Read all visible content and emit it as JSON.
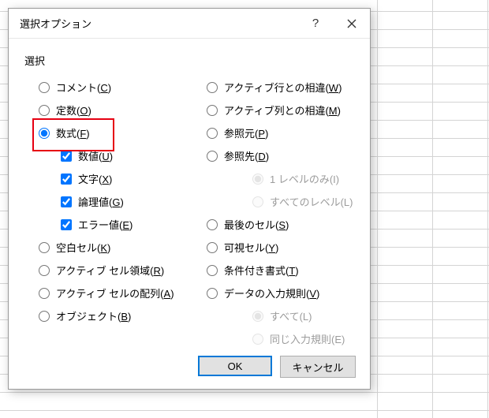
{
  "dialog": {
    "title": "選択オプション",
    "section_label": "選択",
    "left": {
      "comment": {
        "label": "コメント(",
        "accel": "C",
        "suffix": ")"
      },
      "constants": {
        "label": "定数(",
        "accel": "O",
        "suffix": ")"
      },
      "formulas": {
        "label": "数式(",
        "accel": "F",
        "suffix": ")"
      },
      "sub_number": {
        "label": "数値(",
        "accel": "U",
        "suffix": ")"
      },
      "sub_text": {
        "label": "文字(",
        "accel": "X",
        "suffix": ")"
      },
      "sub_logical": {
        "label": "論理値(",
        "accel": "G",
        "suffix": ")"
      },
      "sub_error": {
        "label": "エラー値(",
        "accel": "E",
        "suffix": ")"
      },
      "blanks": {
        "label": "空白セル(",
        "accel": "K",
        "suffix": ")"
      },
      "current_region": {
        "label": "アクティブ セル領域(",
        "accel": "R",
        "suffix": ")"
      },
      "current_array": {
        "label": "アクティブ セルの配列(",
        "accel": "A",
        "suffix": ")"
      },
      "objects": {
        "label": "オブジェクト(",
        "accel": "B",
        "suffix": ")"
      }
    },
    "right": {
      "row_diff": {
        "label": "アクティブ行との相違(",
        "accel": "W",
        "suffix": ")"
      },
      "col_diff": {
        "label": "アクティブ列との相違(",
        "accel": "M",
        "suffix": ")"
      },
      "precedents": {
        "label": "参照元(",
        "accel": "P",
        "suffix": ")"
      },
      "dependents": {
        "label": "参照先(",
        "accel": "D",
        "suffix": ")"
      },
      "level_one": {
        "label": "1 レベルのみ(",
        "accel": "I",
        "suffix": ")"
      },
      "level_all": {
        "label": "すべてのレベル(",
        "accel": "L",
        "suffix": ")"
      },
      "last_cell": {
        "label": "最後のセル(",
        "accel": "S",
        "suffix": ")"
      },
      "visible": {
        "label": "可視セル(",
        "accel": "Y",
        "suffix": ")"
      },
      "cond_fmt": {
        "label": "条件付き書式(",
        "accel": "T",
        "suffix": ")"
      },
      "validation": {
        "label": "データの入力規則(",
        "accel": "V",
        "suffix": ")"
      },
      "val_all": {
        "label": "すべて(",
        "accel": "L",
        "suffix": ")"
      },
      "val_same": {
        "label": "同じ入力規則(",
        "accel": "E",
        "suffix": ")"
      }
    },
    "buttons": {
      "ok": "OK",
      "cancel": "キャンセル"
    }
  }
}
